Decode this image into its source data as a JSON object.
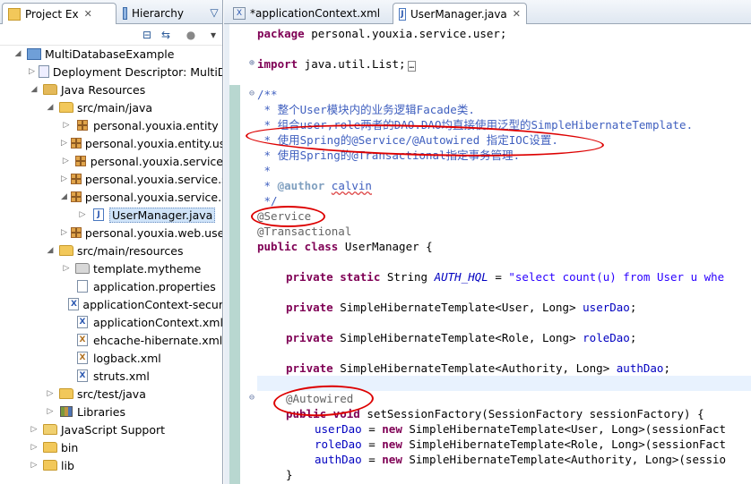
{
  "left": {
    "tabs": [
      {
        "label": "Project Ex"
      },
      {
        "label": "Hierarchy"
      }
    ],
    "tree": [
      {
        "label": "MultiDatabaseExample"
      },
      {
        "label": "Deployment Descriptor: MultiDa"
      },
      {
        "label": "Java Resources"
      },
      {
        "label": "src/main/java"
      },
      {
        "label": "personal.youxia.entity"
      },
      {
        "label": "personal.youxia.entity.use"
      },
      {
        "label": "personal.youxia.service"
      },
      {
        "label": "personal.youxia.service.s"
      },
      {
        "label": "personal.youxia.service.u"
      },
      {
        "label": "UserManager.java"
      },
      {
        "label": "personal.youxia.web.user"
      },
      {
        "label": "src/main/resources"
      },
      {
        "label": "template.mytheme"
      },
      {
        "label": "application.properties"
      },
      {
        "label": "applicationContext-secur"
      },
      {
        "label": "applicationContext.xml"
      },
      {
        "label": "ehcache-hibernate.xml"
      },
      {
        "label": "logback.xml"
      },
      {
        "label": "struts.xml"
      },
      {
        "label": "src/test/java"
      },
      {
        "label": "Libraries"
      },
      {
        "label": "JavaScript Support"
      },
      {
        "label": "bin"
      },
      {
        "label": "lib"
      }
    ]
  },
  "editor": {
    "tabs": [
      {
        "label": "*applicationContext.xml"
      },
      {
        "label": "UserManager.java"
      }
    ],
    "code": {
      "l_package_kw": "package",
      "l_package_rest": " personal.youxia.service.user;",
      "l_import_kw": "import",
      "l_import_rest": " java.util.List;",
      "l_import_box": "…",
      "l_javadoc_open": "/**",
      "l_doc1": " * 整个User模块内的业务逻辑Facade类.",
      "l_doc2": " * 组合user,role两者的DAO.DAO均直接使用泛型的SimpleHibernateTemplate.",
      "l_doc3": " * 使用Spring的@Service/@Autowired 指定IOC设置.",
      "l_doc4": " * 使用Spring的@Transactional指定事务管理.",
      "l_doc5": " *",
      "l_doc6_prefix": " * ",
      "l_doc6_tag": "@author",
      "l_doc6_name": "calvin",
      "l_doc_close": " */",
      "l_service": "@Service",
      "l_transactional": "@Transactional",
      "l_class_kw": "public class",
      "l_class_rest": " UserManager {",
      "l_authhql_kw": "private static",
      "l_authhql_type": " String ",
      "l_authhql_field": "AUTH_HQL",
      "l_authhql_eq": " = ",
      "l_authhql_str": "\"select count(u) from User u whe",
      "l_userdao_kw": "private",
      "l_userdao_type": " SimpleHibernateTemplate<User, Long> ",
      "l_userdao_field": "userDao",
      "l_roledao_kw": "private",
      "l_roledao_type": " SimpleHibernateTemplate<Role, Long> ",
      "l_roledao_field": "roleDao",
      "l_authdao_kw": "private",
      "l_authdao_type": " SimpleHibernateTemplate<Authority, Long> ",
      "l_authdao_field": "authDao",
      "l_autowired": "@Autowired",
      "l_setsf_kw": "public void",
      "l_setsf_rest": " setSessionFactory(SessionFactory sessionFactory) {",
      "l_a1_field": "userDao",
      "l_a1_eq": " = ",
      "l_a1_kw": "new",
      "l_a1_rest": " SimpleHibernateTemplate<User, Long>(sessionFact",
      "l_a2_field": "roleDao",
      "l_a2_eq": " = ",
      "l_a2_kw": "new",
      "l_a2_rest": " SimpleHibernateTemplate<Role, Long>(sessionFact",
      "l_a3_field": "authDao",
      "l_a3_eq": " = ",
      "l_a3_kw": "new",
      "l_a3_rest": " SimpleHibernateTemplate<Authority, Long>(sessio",
      "l_close_brace": "}"
    }
  },
  "colors": {
    "keyword": "#7f0055",
    "comment": "#3f5fbf",
    "annotation": "#646464",
    "string": "#2a00ff",
    "field": "#0000c0",
    "highlight_marker": "#dd0000"
  }
}
